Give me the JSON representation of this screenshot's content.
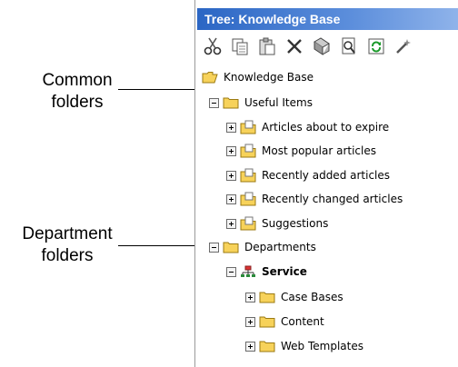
{
  "annotations": {
    "common": [
      "Common",
      "folders"
    ],
    "department": [
      "Department",
      "folders"
    ]
  },
  "panel": {
    "title": "Tree: Knowledge Base"
  },
  "toolbar": {
    "buttons": [
      "cut-icon",
      "copy-icon",
      "paste-icon",
      "delete-icon",
      "properties-icon",
      "search-icon",
      "refresh-icon",
      "wizard-icon"
    ]
  },
  "tree": {
    "root": "Knowledge Base",
    "useful": "Useful Items",
    "useful_children": [
      "Articles about to expire",
      "Most popular articles",
      "Recently added articles",
      "Recently changed articles",
      "Suggestions"
    ],
    "departments": "Departments",
    "service": "Service",
    "service_children": [
      "Case Bases",
      "Content",
      "Web Templates"
    ]
  },
  "colors": {
    "title_bar": "#2b66c4",
    "folder": "#f7d25a"
  }
}
